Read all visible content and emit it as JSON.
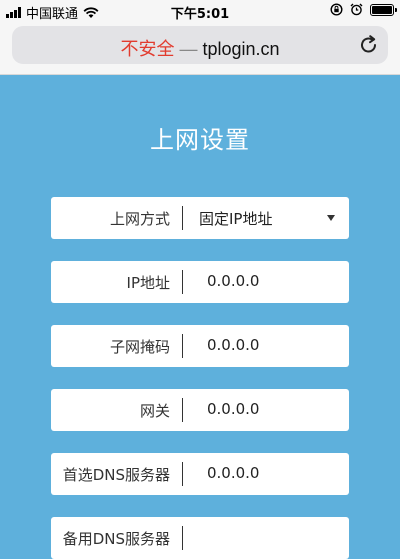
{
  "status_bar": {
    "carrier": "中国联通",
    "time": "下午5:01"
  },
  "address_bar": {
    "security_label": "不安全",
    "separator": "—",
    "host": "tplogin.cn"
  },
  "page": {
    "title": "上网设置",
    "fields": [
      {
        "label": "上网方式",
        "value": "固定IP地址"
      },
      {
        "label": "IP地址",
        "value": "0.0.0.0"
      },
      {
        "label": "子网掩码",
        "value": "0.0.0.0"
      },
      {
        "label": "网关",
        "value": "0.0.0.0"
      },
      {
        "label": "首选DNS服务器",
        "value": "0.0.0.0"
      },
      {
        "label": "备用DNS服务器",
        "value": ""
      }
    ]
  },
  "colors": {
    "background": "#5eb0dc",
    "unsafe_text": "#e23b2e"
  },
  "icons": [
    "signal-icon",
    "wifi-icon",
    "orientation-lock-icon",
    "alarm-icon",
    "battery-icon",
    "reload-icon",
    "dropdown-caret-icon"
  ]
}
